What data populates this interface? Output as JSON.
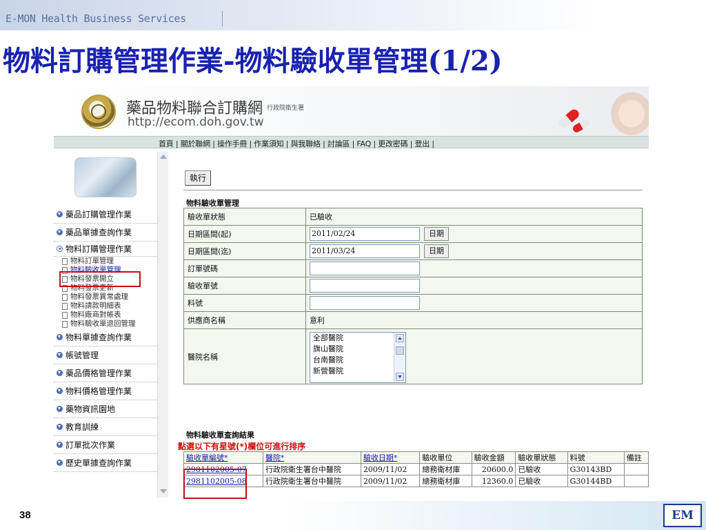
{
  "header": {
    "company": "E-MON Health Business Services",
    "title": "物料訂購管理作業-物料驗收單管理(1/2)"
  },
  "site": {
    "name": "藥品物料聯合訂購網",
    "agency": "行政院衛生署",
    "url": "http://ecom.doh.gov.tw",
    "nav": "首頁 | 關於聯網 | 操作手冊 | 作業須知 | 與我聯絡 | 討論區 | FAQ | 更改密碼 | 登出 |"
  },
  "sidebar": {
    "items": [
      {
        "label": "藥品訂購管理作業"
      },
      {
        "label": "藥品單據查詢作業"
      },
      {
        "label": "物料訂購管理作業"
      }
    ],
    "subitems": [
      {
        "label": "物料訂單管理"
      },
      {
        "label": "物料驗收單管理"
      },
      {
        "label": "物料發票開立"
      },
      {
        "label": "物料發票更新"
      },
      {
        "label": "物料發票異常處理"
      },
      {
        "label": "物料請款明細表"
      },
      {
        "label": "物料廠商對帳表"
      },
      {
        "label": "物料驗收單退回管理"
      }
    ],
    "items_after": [
      {
        "label": "物料單據查詢作業"
      },
      {
        "label": "帳號管理"
      },
      {
        "label": "藥品價格管理作業"
      },
      {
        "label": "物料價格管理作業"
      },
      {
        "label": "藥物資訊園地"
      },
      {
        "label": "教育訓練"
      },
      {
        "label": "訂單批次作業"
      },
      {
        "label": "歷史單據查詢作業"
      }
    ]
  },
  "form": {
    "execute_label": "執行",
    "section_title": "物料驗收單管理",
    "rows": {
      "status": {
        "label": "驗收單狀態",
        "value": "已驗收"
      },
      "date_start": {
        "label": "日期區間(起)",
        "value": "2011/02/24",
        "button": "日期"
      },
      "date_end": {
        "label": "日期區間(迄)",
        "value": "2011/03/24",
        "button": "日期"
      },
      "order_no": {
        "label": "訂單號碼",
        "value": ""
      },
      "receipt_no": {
        "label": "驗收單號",
        "value": ""
      },
      "item_no": {
        "label": "料號",
        "value": ""
      },
      "supplier": {
        "label": "供應商名稱",
        "value": "意利"
      },
      "hospital": {
        "label": "醫院名稱",
        "options": [
          "全部醫院",
          "旗山醫院",
          "台南醫院",
          "新營醫院"
        ]
      }
    }
  },
  "results": {
    "title": "物料驗收單查詢結果",
    "sort_note": "點選以下有星號(*)欄位可進行排序",
    "columns": [
      "驗收單編號*",
      "醫院*",
      "驗收日期*",
      "驗收單位",
      "驗收金額",
      "驗收單狀態",
      "料號",
      "備註"
    ],
    "rows": [
      [
        "2981102005-07",
        "行政院衛生署台中醫院",
        "2009/11/02",
        "總務衛材庫",
        "20600.0",
        "已驗收",
        "G30143BD",
        ""
      ],
      [
        "2981102005-08",
        "行政院衛生署台中醫院",
        "2009/11/02",
        "總務衛材庫",
        "12360.0",
        "已驗收",
        "G30144BD",
        ""
      ]
    ]
  },
  "footer": {
    "page_number": "38",
    "logo_text": "EM"
  }
}
